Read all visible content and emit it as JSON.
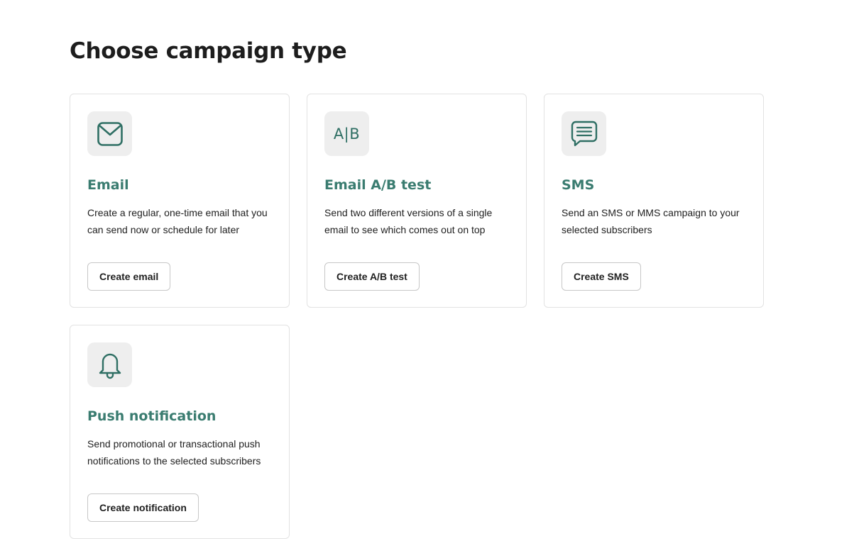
{
  "page": {
    "title": "Choose campaign type"
  },
  "colors": {
    "accent": "#3a7c70",
    "icon": "#2f6f64",
    "icon_tile": "#eeeeee",
    "card_border": "#e2e2e2"
  },
  "cards": [
    {
      "icon": "envelope-icon",
      "title": "Email",
      "description": "Create a regular, one-time email that you can send now or schedule for later",
      "button": "Create email"
    },
    {
      "icon": "ab-test-icon",
      "icon_text": "A|B",
      "title": "Email A/B test",
      "description": "Send two different versions of a single email to see which comes out on top",
      "button": "Create A/B test"
    },
    {
      "icon": "chat-bubble-icon",
      "title": "SMS",
      "description": "Send an SMS or MMS campaign to your selected subscribers",
      "button": "Create SMS"
    },
    {
      "icon": "bell-icon",
      "title": "Push notification",
      "description": "Send promotional or transactional push notifications to the selected subscribers",
      "button": "Create notification"
    }
  ]
}
